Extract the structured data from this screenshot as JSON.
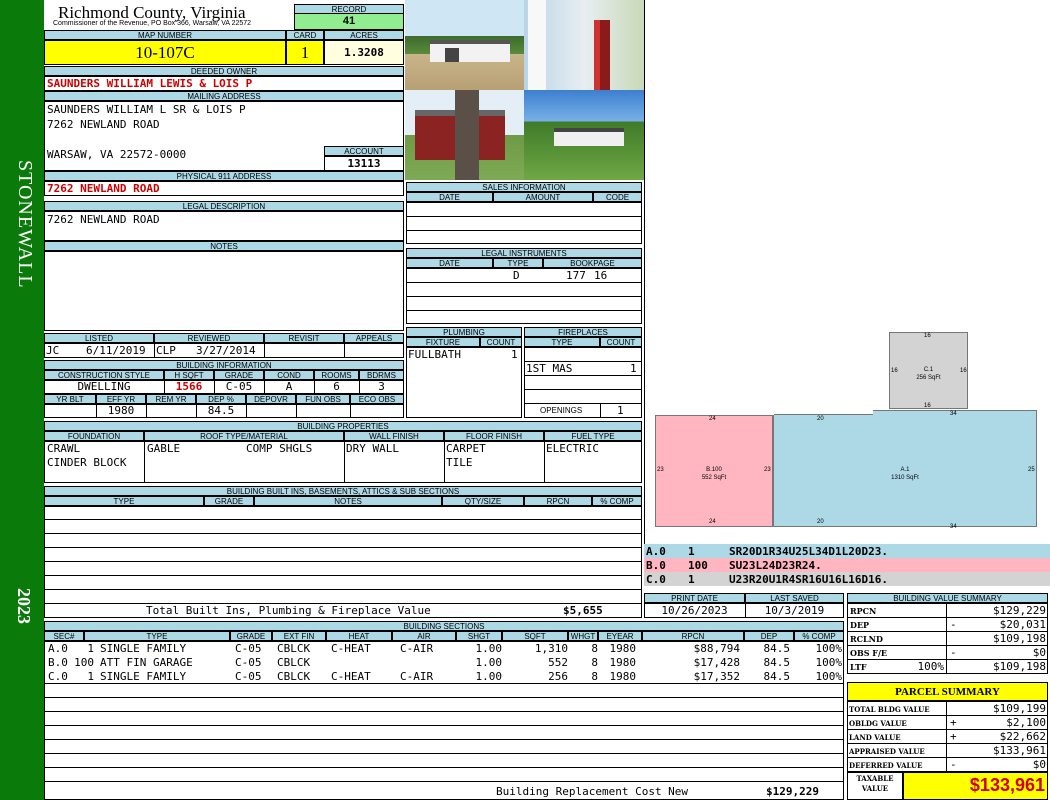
{
  "side": {
    "district": "STONEWALL",
    "year": "2023"
  },
  "header": {
    "county": "Richmond County, Virginia",
    "address": "Commissioner of the Revenue, PO Box 366, Warsaw, VA 22572"
  },
  "record": {
    "label": "RECORD",
    "value": "41"
  },
  "map": {
    "label": "MAP NUMBER",
    "value": "10-107C"
  },
  "card": {
    "label": "CARD",
    "value": "1"
  },
  "acres": {
    "label": "ACRES",
    "value": "1.3208"
  },
  "owner": {
    "label": "DEEDED OWNER",
    "value": "SAUNDERS WILLIAM LEWIS & LOIS P"
  },
  "mailing": {
    "label": "MAILING ADDRESS",
    "line1": "SAUNDERS WILLIAM L SR & LOIS P",
    "line2": "7262 NEWLAND ROAD",
    "line3": "WARSAW, VA 22572-0000"
  },
  "account": {
    "label": "ACCOUNT",
    "value": "13113"
  },
  "physical": {
    "label": "PHYSICAL 911 ADDRESS",
    "value": "7262 NEWLAND ROAD"
  },
  "legal": {
    "label": "LEGAL DESCRIPTION",
    "value": "7262 NEWLAND ROAD"
  },
  "notes": {
    "label": "NOTES"
  },
  "review": {
    "listed_label": "LISTED",
    "reviewed_label": "REVIEWED",
    "revisit_label": "REVISIT",
    "appeals_label": "APPEALS",
    "listed_by": "JC",
    "listed_date": "6/11/2019",
    "reviewed_by": "CLP",
    "reviewed_date": "3/27/2014"
  },
  "bldg_info": {
    "label": "BUILDING INFORMATION",
    "style_label": "CONSTRUCTION STYLE",
    "hsqft_label": "H SQFT",
    "grade_label": "GRADE",
    "cond_label": "COND",
    "rooms_label": "ROOMS",
    "bdrms_label": "BDRMS",
    "style": "DWELLING",
    "hsqft": "1566",
    "grade": "C-05",
    "cond": "A",
    "rooms": "6",
    "bdrms": "3",
    "yrblt_label": "YR BLT",
    "effyr_label": "EFF YR",
    "remyr_label": "REM YR",
    "dep_label": "DEP %",
    "depovr_label": "DEPOVR",
    "funobs_label": "FUN OBS",
    "ecoobs_label": "ECO OBS",
    "effyr": "1980",
    "dep": "84.5"
  },
  "props": {
    "label": "BUILDING PROPERTIES",
    "foundation_label": "FOUNDATION",
    "roof_label": "ROOF TYPE/MATERIAL",
    "wall_label": "WALL FINISH",
    "floor_label": "FLOOR FINISH",
    "fuel_label": "FUEL TYPE",
    "foundation1": "CRAWL",
    "foundation2": "CINDER BLOCK",
    "roof_type": "GABLE",
    "roof_mat": "COMP SHGLS",
    "wall": "DRY WALL",
    "floor1": "CARPET",
    "floor2": "TILE",
    "fuel": "ELECTRIC"
  },
  "builtins": {
    "label": "BUILDING BUILT INS, BASEMENTS, ATTICS & SUB SECTIONS",
    "cols": [
      "TYPE",
      "GRADE",
      "NOTES",
      "QTY/SIZE",
      "RPCN",
      "% COMP"
    ],
    "total_label": "Total Built Ins, Plumbing & Fireplace Value",
    "total_value": "$5,655"
  },
  "sales": {
    "label": "SALES INFORMATION",
    "cols": [
      "DATE",
      "AMOUNT",
      "CODE"
    ]
  },
  "instruments": {
    "label": "LEGAL INSTRUMENTS",
    "cols": [
      "DATE",
      "TYPE",
      "BOOKPAGE"
    ],
    "type": "D",
    "book": "177",
    "page": "16"
  },
  "plumbing": {
    "label": "PLUMBING",
    "fixture_label": "FIXTURE",
    "count_label": "COUNT",
    "fixture": "FULLBATH",
    "count": "1"
  },
  "fireplaces": {
    "label": "FIREPLACES",
    "type_label": "TYPE",
    "count_label": "COUNT",
    "type": "1ST MAS",
    "count": "1",
    "openings_label": "OPENINGS",
    "openings": "1"
  },
  "sketch": {
    "C1": {
      "label": "C.1",
      "area": "256 SqFt",
      "top": "16",
      "left": "16",
      "right": "16",
      "bottom": "16"
    },
    "B100": {
      "label": "B.100",
      "area": "552 SqFt",
      "top": "24",
      "left": "23",
      "right": "23",
      "bottom": "24"
    },
    "A1": {
      "label": "A.1",
      "area": "1310 SqFt",
      "top1": "20",
      "top2": "34",
      "right": "25",
      "bottom1": "20",
      "bottom2": "34"
    },
    "colors": {
      "a": "#add8e6",
      "b": "#ffb6c1",
      "c": "#d3d3d3"
    }
  },
  "codes": [
    {
      "sec": "A.0",
      "num": "1",
      "code": "SR20D1R34U25L34D1L20D23."
    },
    {
      "sec": "B.0",
      "num": "100",
      "code": "SU23L24D23R24."
    },
    {
      "sec": "C.0",
      "num": "1",
      "code": "U23R20U1R4SR16U16L16D16."
    }
  ],
  "print": {
    "print_label": "PRINT DATE",
    "saved_label": "LAST SAVED",
    "print_date": "10/26/2023",
    "saved_date": "10/3/2019"
  },
  "sections": {
    "label": "BUILDING SECTIONS",
    "cols": [
      "SEC#",
      "TYPE",
      "GRADE",
      "EXT FIN",
      "HEAT",
      "AIR",
      "SHGT",
      "SQFT",
      "WHGT",
      "EYEAR",
      "RPCN",
      "DEP",
      "% COMP"
    ],
    "rows": [
      {
        "sec": "A.0",
        "num": "1",
        "type": "SINGLE FAMILY",
        "grade": "C-05",
        "ext": "CBLCK",
        "heat": "C-HEAT",
        "air": "C-AIR",
        "shgt": "1.00",
        "sqft": "1,310",
        "whgt": "8",
        "eyear": "1980",
        "rpcn": "$88,794",
        "dep": "84.5",
        "comp": "100%"
      },
      {
        "sec": "B.0",
        "num": "100",
        "type": "ATT FIN GARAGE",
        "grade": "C-05",
        "ext": "CBLCK",
        "heat": "",
        "air": "",
        "shgt": "1.00",
        "sqft": "552",
        "whgt": "8",
        "eyear": "1980",
        "rpcn": "$17,428",
        "dep": "84.5",
        "comp": "100%"
      },
      {
        "sec": "C.0",
        "num": "1",
        "type": "SINGLE FAMILY",
        "grade": "C-05",
        "ext": "CBLCK",
        "heat": "C-HEAT",
        "air": "C-AIR",
        "shgt": "1.00",
        "sqft": "256",
        "whgt": "8",
        "eyear": "1980",
        "rpcn": "$17,352",
        "dep": "84.5",
        "comp": "100%"
      }
    ],
    "replacement_label": "Building Replacement Cost New",
    "replacement_value": "$129,229"
  },
  "bvs": {
    "label": "BUILDING VALUE SUMMARY",
    "rows": [
      {
        "label": "RPCN",
        "op": "",
        "value": "$129,229"
      },
      {
        "label": "DEP",
        "op": "-",
        "value": "$20,031"
      },
      {
        "label": "RCLND",
        "op": "",
        "value": "$109,198"
      },
      {
        "label": "OBS F/E",
        "op": "-",
        "value": "$0"
      },
      {
        "label": "LTF",
        "pct": "100%",
        "op": "",
        "value": "$109,198"
      }
    ]
  },
  "parcel": {
    "label": "PARCEL SUMMARY",
    "rows": [
      {
        "label": "TOTAL BLDG VALUE",
        "op": "",
        "value": "$109,199"
      },
      {
        "label": "OBLDG VALUE",
        "op": "+",
        "value": "$2,100"
      },
      {
        "label": "LAND VALUE",
        "op": "+",
        "value": "$22,662"
      },
      {
        "label": "APPRAISED VALUE",
        "op": "",
        "value": "$133,961"
      },
      {
        "label": "DEFERRED VALUE",
        "op": "-",
        "value": "$0"
      }
    ],
    "taxable_label1": "TAXABLE",
    "taxable_label2": "VALUE",
    "taxable_value": "$133,961"
  }
}
